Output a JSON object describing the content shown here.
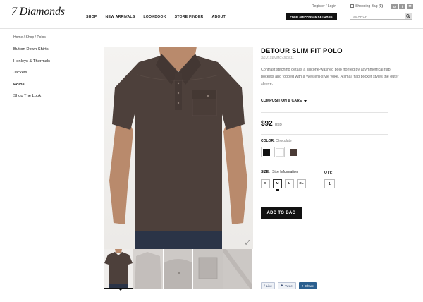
{
  "brand": {
    "logo": "7 Diamonds"
  },
  "nav": {
    "items": [
      "SHOP",
      "NEW ARRIVALS",
      "LOOKBOOK",
      "STORE FINDER",
      "ABOUT"
    ]
  },
  "utility": {
    "account": "Register / Login",
    "bag_label": "Shopping Bag",
    "bag_count": "(0)",
    "social": [
      "p",
      "f",
      "✉"
    ]
  },
  "banner": {
    "shipping": "FREE SHIPPING & RETURNS"
  },
  "search": {
    "placeholder": "SEARCH"
  },
  "breadcrumb": "Home / Shop / Polos",
  "sidebar": {
    "items": [
      {
        "label": "Button Down Shirts",
        "active": false
      },
      {
        "label": "Henleys & Thermals",
        "active": false
      },
      {
        "label": "Jackets",
        "active": false
      },
      {
        "label": "Polos",
        "active": true
      },
      {
        "label": "Shop The Look",
        "active": false
      }
    ]
  },
  "product": {
    "title": "DETOUR SLIM FIT POLO",
    "sku": "SKU: SEVMC4SO811",
    "description": "Contrast stitching details a silicone-washed polo fronted by asymmetrical flap pockets and topped with a Western-style yoke. A small flap pocket styles the outer sleeve.",
    "composition_label": "COMPOSITION & CARE",
    "price": "$92",
    "currency": "USD",
    "color_label": "COLOR:",
    "color_value": "Chocolate",
    "colors": [
      {
        "hex": "#111111",
        "selected": false
      },
      {
        "hex": "#ffffff",
        "selected": false
      },
      {
        "hex": "#4a3b36",
        "selected": true
      }
    ],
    "size_label": "SIZE:",
    "size_info": "Size Information",
    "sizes": [
      {
        "label": "S",
        "selected": false
      },
      {
        "label": "M",
        "selected": true
      },
      {
        "label": "L",
        "selected": false
      },
      {
        "label": "XL",
        "selected": false
      }
    ],
    "qty_label": "QTY:",
    "qty": "1",
    "add_to_bag": "ADD TO BAG"
  },
  "share": {
    "like": "Like",
    "tweet": "Tweet",
    "share": "Share"
  },
  "colors": {
    "accent": "#111111",
    "shirt": "#4d403b",
    "skin": "#b98a6c",
    "denim": "#2b3447"
  }
}
